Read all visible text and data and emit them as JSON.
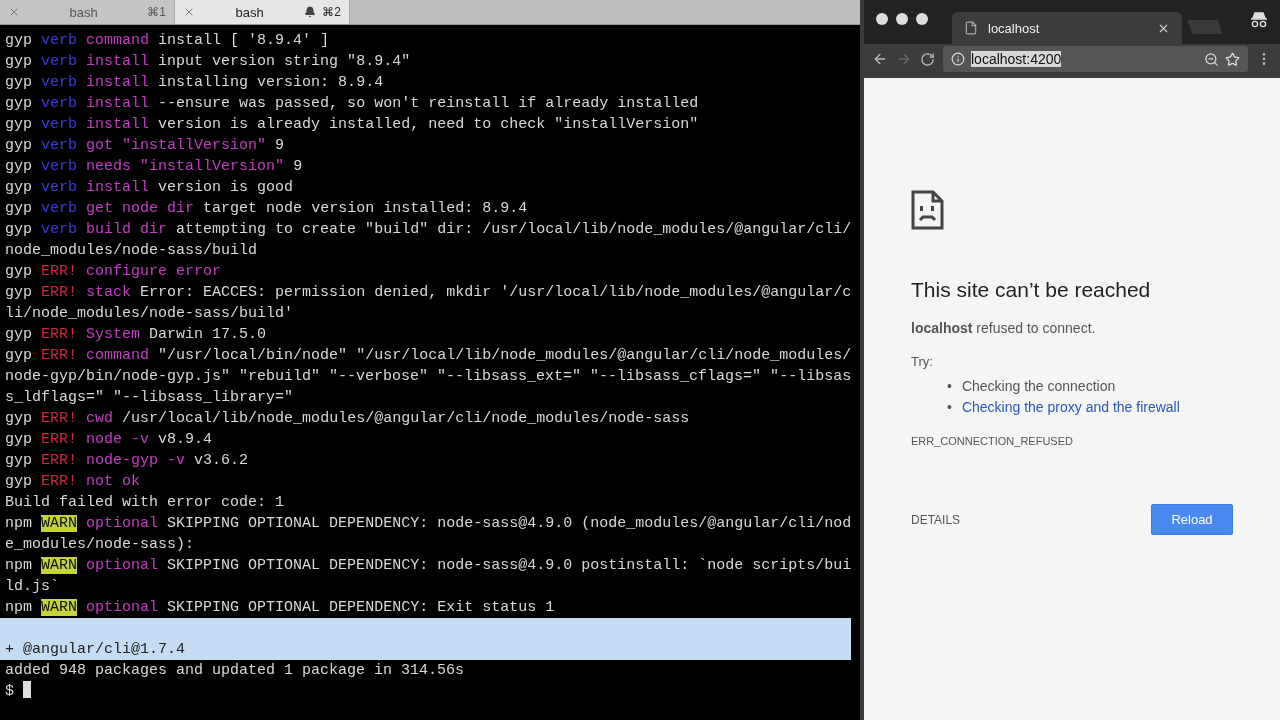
{
  "terminal": {
    "tabs": [
      {
        "title": "bash",
        "shortcut": "⌘1",
        "selected": false,
        "bell": false
      },
      {
        "title": "bash",
        "shortcut": "⌘2",
        "selected": true,
        "bell": true
      }
    ],
    "lines": [
      {
        "selected": false,
        "segments": [
          {
            "kind": "plain",
            "text": "gyp"
          },
          {
            "kind": "verb",
            "text": "verb"
          },
          {
            "kind": "keyword",
            "text": "command"
          },
          {
            "kind": "plain",
            "text": "install [ '8.9.4' ]"
          }
        ]
      },
      {
        "selected": false,
        "segments": [
          {
            "kind": "plain",
            "text": "gyp"
          },
          {
            "kind": "verb",
            "text": "verb"
          },
          {
            "kind": "keyword",
            "text": "install"
          },
          {
            "kind": "plain",
            "text": "input version string \"8.9.4\""
          }
        ]
      },
      {
        "selected": false,
        "segments": [
          {
            "kind": "plain",
            "text": "gyp"
          },
          {
            "kind": "verb",
            "text": "verb"
          },
          {
            "kind": "keyword",
            "text": "install"
          },
          {
            "kind": "plain",
            "text": "installing version: 8.9.4"
          }
        ]
      },
      {
        "selected": false,
        "segments": [
          {
            "kind": "plain",
            "text": "gyp"
          },
          {
            "kind": "verb",
            "text": "verb"
          },
          {
            "kind": "keyword",
            "text": "install"
          },
          {
            "kind": "plain",
            "text": "--ensure was passed, so won't reinstall if already installed"
          }
        ]
      },
      {
        "selected": false,
        "segments": [
          {
            "kind": "plain",
            "text": "gyp"
          },
          {
            "kind": "verb",
            "text": "verb"
          },
          {
            "kind": "keyword",
            "text": "install"
          },
          {
            "kind": "plain",
            "text": "version is already installed, need to check \"installVersion\""
          }
        ]
      },
      {
        "selected": false,
        "segments": [
          {
            "kind": "plain",
            "text": "gyp"
          },
          {
            "kind": "verb",
            "text": "verb"
          },
          {
            "kind": "keyword",
            "text": "got \"installVersion\""
          },
          {
            "kind": "plain",
            "text": "9"
          }
        ]
      },
      {
        "selected": false,
        "segments": [
          {
            "kind": "plain",
            "text": "gyp"
          },
          {
            "kind": "verb",
            "text": "verb"
          },
          {
            "kind": "keyword",
            "text": "needs \"installVersion\""
          },
          {
            "kind": "plain",
            "text": "9"
          }
        ]
      },
      {
        "selected": false,
        "segments": [
          {
            "kind": "plain",
            "text": "gyp"
          },
          {
            "kind": "verb",
            "text": "verb"
          },
          {
            "kind": "keyword",
            "text": "install"
          },
          {
            "kind": "plain",
            "text": "version is good"
          }
        ]
      },
      {
        "selected": false,
        "segments": [
          {
            "kind": "plain",
            "text": "gyp"
          },
          {
            "kind": "verb",
            "text": "verb"
          },
          {
            "kind": "keyword",
            "text": "get node dir"
          },
          {
            "kind": "plain",
            "text": "target node version installed: 8.9.4"
          }
        ]
      },
      {
        "selected": false,
        "segments": [
          {
            "kind": "plain",
            "text": "gyp"
          },
          {
            "kind": "verb",
            "text": "verb"
          },
          {
            "kind": "keyword",
            "text": "build dir"
          },
          {
            "kind": "plain",
            "text": "attempting to create \"build\" dir: /usr/local/lib/node_modules/@angular/cli/"
          }
        ]
      },
      {
        "selected": false,
        "segments": [
          {
            "kind": "plain",
            "text": "node_modules/node-sass/build"
          }
        ]
      },
      {
        "selected": false,
        "segments": [
          {
            "kind": "plain",
            "text": "gyp"
          },
          {
            "kind": "err",
            "text": "ERR!"
          },
          {
            "kind": "keyword",
            "text": "configure error"
          }
        ]
      },
      {
        "selected": false,
        "segments": [
          {
            "kind": "plain",
            "text": "gyp"
          },
          {
            "kind": "err",
            "text": "ERR!"
          },
          {
            "kind": "keyword",
            "text": "stack"
          },
          {
            "kind": "plain",
            "text": "Error: EACCES: permission denied, mkdir '/usr/local/lib/node_modules/@angular/c"
          }
        ]
      },
      {
        "selected": false,
        "segments": [
          {
            "kind": "plain",
            "text": "li/node_modules/node-sass/build'"
          }
        ]
      },
      {
        "selected": false,
        "segments": [
          {
            "kind": "plain",
            "text": "gyp"
          },
          {
            "kind": "err",
            "text": "ERR!"
          },
          {
            "kind": "keyword",
            "text": "System"
          },
          {
            "kind": "plain",
            "text": "Darwin 17.5.0"
          }
        ]
      },
      {
        "selected": false,
        "segments": [
          {
            "kind": "plain",
            "text": "gyp"
          },
          {
            "kind": "err",
            "text": "ERR!"
          },
          {
            "kind": "keyword",
            "text": "command"
          },
          {
            "kind": "plain",
            "text": "\"/usr/local/bin/node\" \"/usr/local/lib/node_modules/@angular/cli/node_modules/"
          }
        ]
      },
      {
        "selected": false,
        "segments": [
          {
            "kind": "plain",
            "text": "node-gyp/bin/node-gyp.js\" \"rebuild\" \"--verbose\" \"--libsass_ext=\" \"--libsass_cflags=\" \"--libsas"
          }
        ]
      },
      {
        "selected": false,
        "segments": [
          {
            "kind": "plain",
            "text": "s_ldflags=\" \"--libsass_library=\""
          }
        ]
      },
      {
        "selected": false,
        "segments": [
          {
            "kind": "plain",
            "text": "gyp"
          },
          {
            "kind": "err",
            "text": "ERR!"
          },
          {
            "kind": "keyword",
            "text": "cwd"
          },
          {
            "kind": "plain",
            "text": "/usr/local/lib/node_modules/@angular/cli/node_modules/node-sass"
          }
        ]
      },
      {
        "selected": false,
        "segments": [
          {
            "kind": "plain",
            "text": "gyp"
          },
          {
            "kind": "err",
            "text": "ERR!"
          },
          {
            "kind": "keyword",
            "text": "node -v"
          },
          {
            "kind": "plain",
            "text": "v8.9.4"
          }
        ]
      },
      {
        "selected": false,
        "segments": [
          {
            "kind": "plain",
            "text": "gyp"
          },
          {
            "kind": "err",
            "text": "ERR!"
          },
          {
            "kind": "keyword",
            "text": "node-gyp -v"
          },
          {
            "kind": "plain",
            "text": "v3.6.2"
          }
        ]
      },
      {
        "selected": false,
        "segments": [
          {
            "kind": "plain",
            "text": "gyp"
          },
          {
            "kind": "err",
            "text": "ERR!"
          },
          {
            "kind": "keyword",
            "text": "not ok"
          }
        ]
      },
      {
        "selected": false,
        "segments": [
          {
            "kind": "plain",
            "text": "Build failed with error code: 1"
          }
        ]
      },
      {
        "selected": false,
        "segments": [
          {
            "kind": "plain",
            "text": "npm"
          },
          {
            "kind": "warn",
            "text": "WARN"
          },
          {
            "kind": "keyword",
            "text": "optional"
          },
          {
            "kind": "plain",
            "text": "SKIPPING OPTIONAL DEPENDENCY: node-sass@4.9.0 (node_modules/@angular/cli/nod"
          }
        ]
      },
      {
        "selected": false,
        "segments": [
          {
            "kind": "plain",
            "text": "e_modules/node-sass):"
          }
        ]
      },
      {
        "selected": false,
        "segments": [
          {
            "kind": "plain",
            "text": "npm"
          },
          {
            "kind": "warn",
            "text": "WARN"
          },
          {
            "kind": "keyword",
            "text": "optional"
          },
          {
            "kind": "plain",
            "text": "SKIPPING OPTIONAL DEPENDENCY: node-sass@4.9.0 postinstall: `node scripts/bui"
          }
        ]
      },
      {
        "selected": false,
        "segments": [
          {
            "kind": "plain",
            "text": "ld.js`"
          }
        ]
      },
      {
        "selected": false,
        "segments": [
          {
            "kind": "plain",
            "text": "npm"
          },
          {
            "kind": "warn",
            "text": "WARN"
          },
          {
            "kind": "keyword",
            "text": "optional"
          },
          {
            "kind": "plain",
            "text": "SKIPPING OPTIONAL DEPENDENCY: Exit status 1"
          }
        ]
      },
      {
        "selected": true
      },
      {
        "selected": true,
        "segments": [
          {
            "kind": "plain",
            "text": "+ @angular/cli@1.7.4"
          }
        ]
      },
      {
        "selected": false,
        "segments": [
          {
            "kind": "plain",
            "text": "added 948 packages and updated 1 package in 314.56s"
          }
        ]
      },
      {
        "selected": false,
        "cursor": true,
        "segments": [
          {
            "kind": "plain",
            "text": "$"
          }
        ]
      }
    ]
  },
  "browser": {
    "tab": {
      "title": "localhost"
    },
    "address": {
      "value": "localhost:4200",
      "selected": true
    },
    "forward_disabled": true,
    "error": {
      "title": "This site can’t be reached",
      "message": "**localhost** refused to connect.",
      "try_label": "Try:",
      "suggestions": [
        {
          "kind": "text",
          "bullet": "•",
          "text": "Checking the connection"
        },
        {
          "kind": "link",
          "bullet": "•",
          "text": "Checking the proxy and the firewall"
        }
      ],
      "code": "ERR_CONNECTION_REFUSED",
      "details_button": "DETAILS",
      "reload_button": "Reload"
    }
  }
}
